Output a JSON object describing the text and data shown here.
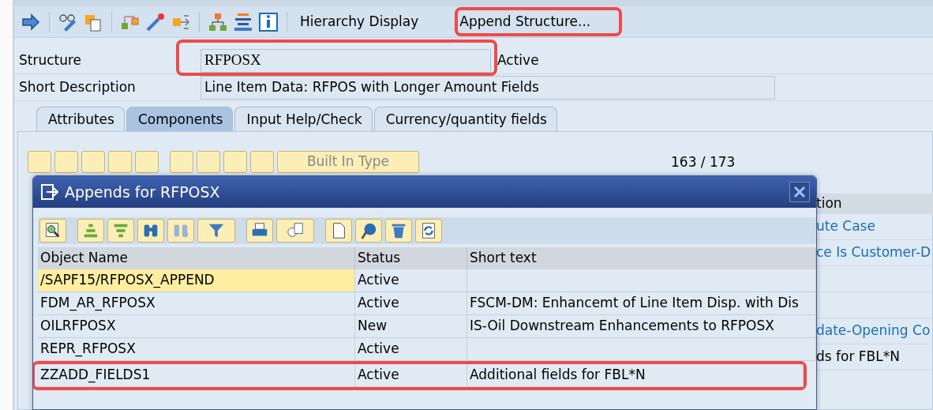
{
  "toolbar": {
    "buttons": [
      {
        "label": "Hierarchy Display",
        "highlighted": false
      },
      {
        "label": "Append Structure...",
        "highlighted": true
      }
    ]
  },
  "header": {
    "fields": [
      {
        "label": "Structure",
        "value": "RFPOSX",
        "status": "Active",
        "highlighted": true
      },
      {
        "label": "Short Description",
        "value": "Line Item Data: RFPOS with Longer Amount Fields",
        "highlighted": false
      }
    ]
  },
  "tabs": [
    {
      "label": "Attributes",
      "selected": false
    },
    {
      "label": "Components",
      "selected": true
    },
    {
      "label": "Input Help/Check",
      "selected": false
    },
    {
      "label": "Currency/quantity fields",
      "selected": false
    }
  ],
  "components": {
    "type_button": "Built In Type",
    "counter": "163  /  173",
    "column_header": "tion",
    "rows": [
      {
        "text": "ute Case",
        "link": true
      },
      {
        "text": "ce Is Customer-D",
        "link": true
      },
      {},
      {},
      {
        "text": "date-Opening Co",
        "link": true
      },
      {
        "text": "ds for FBL*N",
        "link": false
      }
    ]
  },
  "dialog": {
    "title": "Appends for RFPOSX",
    "columns": [
      "Object Name",
      "Status",
      "Short text"
    ],
    "rows": [
      {
        "object_name": "/SAPF15/RFPOSX_APPEND",
        "status": "Active",
        "selected": true,
        "highlighted": false
      },
      {
        "object_name": "FDM_AR_RFPOSX",
        "status": "Active",
        "short_text": "FSCM-DM: Enhancemt of Line Item Disp. with Dis",
        "selected": false,
        "highlighted": false
      },
      {
        "object_name": "OILRFPOSX",
        "status": "New",
        "short_text": "IS-Oil Downstream Enhancements to RFPOSX",
        "selected": false,
        "highlighted": false
      },
      {
        "object_name": "REPR_RFPOSX",
        "status": "Active",
        "selected": false,
        "highlighted": false
      },
      {
        "object_name": "ZZADD_FIELDS1",
        "status": "Active",
        "short_text": "Additional fields for FBL*N",
        "selected": false,
        "highlighted": true
      }
    ]
  }
}
